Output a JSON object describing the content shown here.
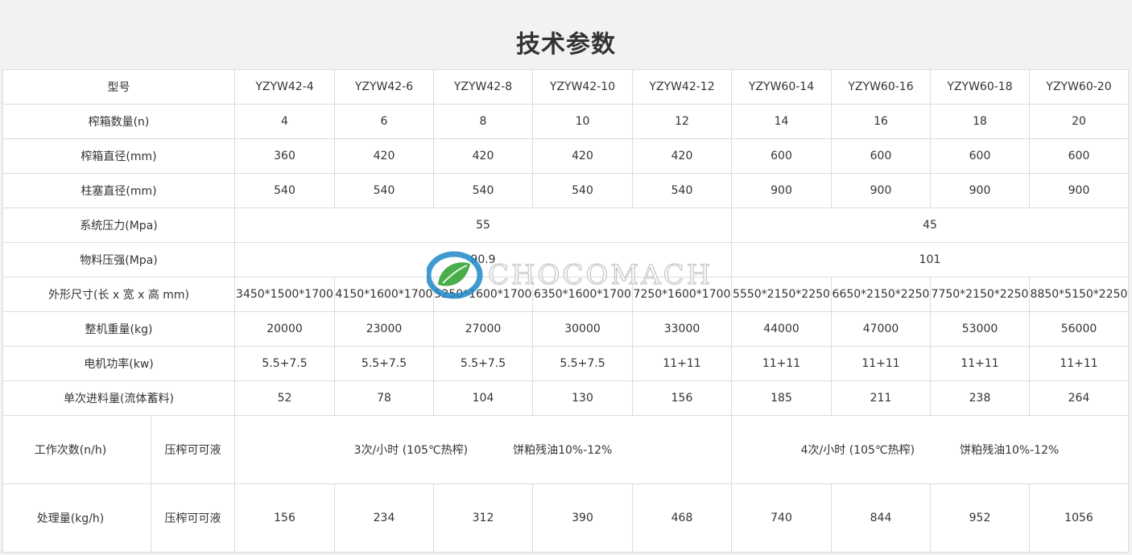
{
  "title": "技术参数",
  "watermark": {
    "text": "CHOCOMACH",
    "logo": "chocomach-leaf-logo",
    "colors": {
      "blue": "#1e88c8",
      "green": "#3aa63a"
    }
  },
  "table": {
    "model_label": "型号",
    "models": [
      "YZYW42-4",
      "YZYW42-6",
      "YZYW42-8",
      "YZYW42-10",
      "YZYW42-12",
      "YZYW60-14",
      "YZYW60-16",
      "YZYW60-18",
      "YZYW60-20"
    ],
    "rows": [
      {
        "label": "榨箱数量(n)",
        "values": [
          "4",
          "6",
          "8",
          "10",
          "12",
          "14",
          "16",
          "18",
          "20"
        ]
      },
      {
        "label": "榨箱直径(mm)",
        "values": [
          "360",
          "420",
          "420",
          "420",
          "420",
          "600",
          "600",
          "600",
          "600"
        ]
      },
      {
        "label": "柱塞直径(mm)",
        "values": [
          "540",
          "540",
          "540",
          "540",
          "540",
          "900",
          "900",
          "900",
          "900"
        ]
      }
    ],
    "pressure": {
      "label": "系统压力(Mpa)",
      "group1": "55",
      "group2": "45"
    },
    "material_pressure": {
      "label": "物料压强(Mpa)",
      "group1": "90.9",
      "group2": "101"
    },
    "rows2": [
      {
        "label": "外形尺寸(长 x 宽 x 高 mm)",
        "values": [
          "3450*1500*1700",
          "4150*1600*1700",
          "5250*1600*1700",
          "6350*1600*1700",
          "7250*1600*1700",
          "5550*2150*2250",
          "6650*2150*2250",
          "7750*2150*2250",
          "8850*5150*2250"
        ]
      },
      {
        "label": "整机重量(kg)",
        "values": [
          "20000",
          "23000",
          "27000",
          "30000",
          "33000",
          "44000",
          "47000",
          "53000",
          "56000"
        ]
      },
      {
        "label": "电机功率(kw)",
        "values": [
          "5.5+7.5",
          "5.5+7.5",
          "5.5+7.5",
          "5.5+7.5",
          "11+11",
          "11+11",
          "11+11",
          "11+11",
          "11+11"
        ]
      },
      {
        "label": "单次进料量(流体蓄料)",
        "values": [
          "52",
          "78",
          "104",
          "130",
          "156",
          "185",
          "211",
          "238",
          "264"
        ]
      }
    ],
    "work_times": {
      "label": "工作次数(n/h)",
      "sublabel": "压榨可可液",
      "group1_rate": "3次/小时 (105℃热榨)",
      "group1_residue": "饼粕残油10%-12%",
      "group2_rate": "4次/小时 (105℃热榨)",
      "group2_residue": "饼粕残油10%-12%"
    },
    "capacity": {
      "label": "处理量(kg/h)",
      "sublabel": "压榨可可液",
      "values": [
        "156",
        "234",
        "312",
        "390",
        "468",
        "740",
        "844",
        "952",
        "1056"
      ]
    }
  }
}
